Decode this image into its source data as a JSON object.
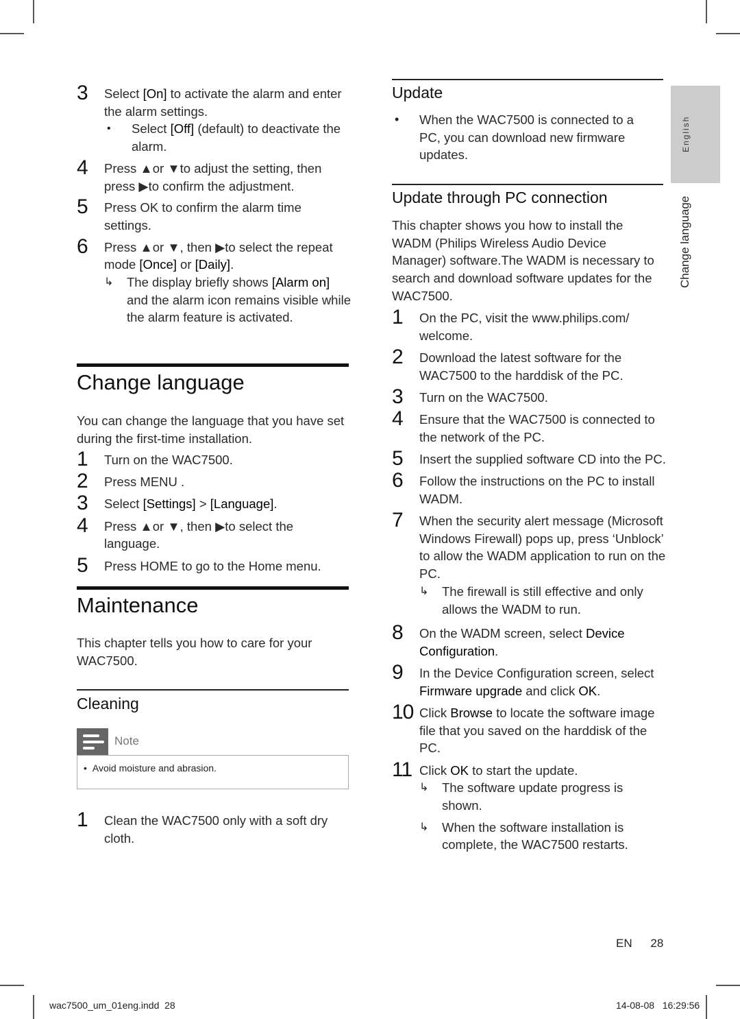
{
  "left_column": {
    "alarm_steps": [
      {
        "num": "3",
        "text_parts": [
          "Select ",
          "[On]",
          " to activate the alarm and enter the alarm settings."
        ],
        "sub": {
          "type": "bullet",
          "symbol": "•",
          "text_parts": [
            "Select ",
            "[Off]",
            " (default) to deactivate the alarm."
          ]
        }
      },
      {
        "num": "4",
        "text": "Press ▲or ▼to adjust the setting, then press ▶to confirm the adjustment."
      },
      {
        "num": "5",
        "text": "Press OK to confirm the alarm time settings."
      },
      {
        "num": "6",
        "text_parts": [
          "Press ▲or ▼, then ▶to select the repeat mode ",
          "[Once]",
          " or ",
          "[Daily]",
          "."
        ],
        "sub": {
          "type": "result",
          "symbol": "↳",
          "text_parts": [
            "The display briefly shows ",
            "[Alarm on]",
            " and the alarm icon remains visible while the alarm feature is activated."
          ]
        }
      }
    ],
    "change_language": {
      "title": "Change language",
      "intro": "You can change the language that you have set during the first-time installation.",
      "steps": [
        {
          "num": "1",
          "text": "Turn on the WAC7500."
        },
        {
          "num": "2",
          "text": "Press MENU ."
        },
        {
          "num": "3",
          "text_parts": [
            "Select ",
            "[Settings]",
            " > ",
            "[Language]",
            "."
          ]
        },
        {
          "num": "4",
          "text": "Press ▲or ▼, then ▶to select the language."
        },
        {
          "num": "5",
          "text": "Press HOME to go to the Home menu."
        }
      ]
    },
    "maintenance": {
      "title": "Maintenance",
      "intro": "This chapter tells you how to care for your WAC7500.",
      "cleaning": {
        "title": "Cleaning",
        "note_label": "Note",
        "note_icon": "note-icon",
        "note_items": [
          "Avoid moisture and abrasion."
        ],
        "steps": [
          {
            "num": "1",
            "text": "Clean the WAC7500 only with a soft dry cloth."
          }
        ]
      }
    }
  },
  "right_column": {
    "update": {
      "title": "Update",
      "bullets": [
        "When the WAC7500 is connected to a PC, you can download new firmware updates."
      ]
    },
    "update_pc": {
      "title": "Update through PC connection",
      "intro": "This chapter shows you how to install the WADM (Philips Wireless Audio Device Manager) software.The WADM is necessary to search and download software updates for the WAC7500.",
      "steps": [
        {
          "num": "1",
          "text": "On the PC, visit the www.philips.com/ welcome."
        },
        {
          "num": "2",
          "text": "Download the latest software for the WAC7500 to the harddisk of the PC."
        },
        {
          "num": "3",
          "text": "Turn on the WAC7500."
        },
        {
          "num": "4",
          "text": "Ensure that the WAC7500 is connected to the network of the PC."
        },
        {
          "num": "5",
          "text": "Insert the supplied software CD into the PC."
        },
        {
          "num": "6",
          "text": "Follow the instructions on the PC to install WADM."
        },
        {
          "num": "7",
          "text": "When the security alert message (Microsoft Windows Firewall) pops up, press ‘Unblock’ to allow the WADM application to run on the PC.",
          "results": [
            "The firewall is still effective and only allows the WADM to run."
          ]
        },
        {
          "num": "8",
          "text_parts": [
            "On the WADM screen, select ",
            "Device Configuration",
            "."
          ]
        },
        {
          "num": "9",
          "text_parts": [
            "In the Device Configuration screen, select ",
            "Firmware upgrade",
            " and click ",
            "OK",
            "."
          ]
        },
        {
          "num": "10",
          "text_parts": [
            "Click ",
            "Browse",
            " to locate the software image file that you saved on the harddisk of the PC."
          ]
        },
        {
          "num": "11",
          "text_parts": [
            "Click ",
            "OK",
            " to start the update."
          ],
          "results": [
            "The software update progress is shown.",
            "When the software installation is complete, the WAC7500 restarts."
          ]
        }
      ]
    }
  },
  "side_tab": {
    "language_tab": "English",
    "section_label": "Change language",
    "tab_color": "#cccccc"
  },
  "footer": {
    "lang": "EN",
    "page": "28",
    "file": "wac7500_um_01eng.indd  28",
    "timestamp": "14-08-08   16:29:56"
  }
}
